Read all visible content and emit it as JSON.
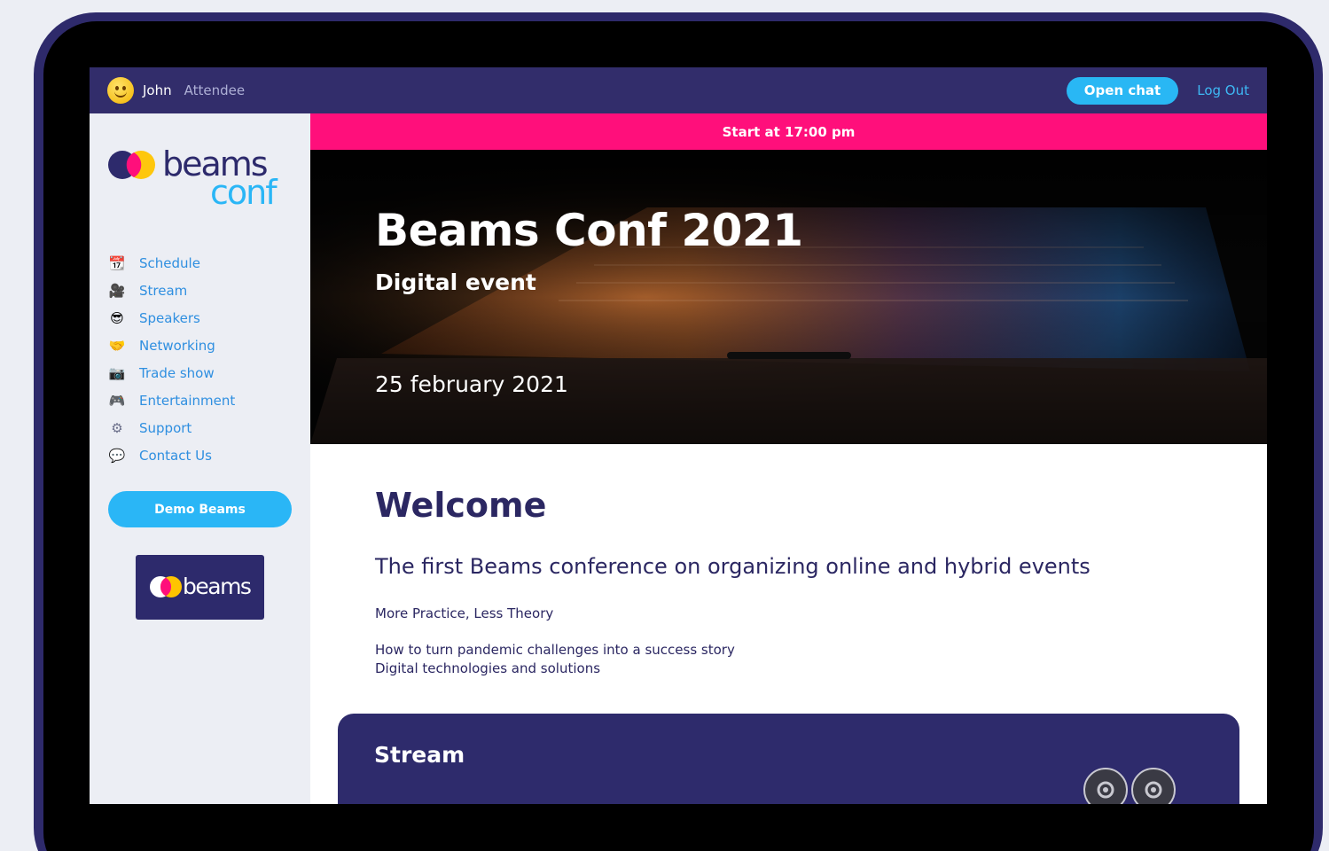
{
  "topbar": {
    "user_name": "John",
    "user_role": "Attendee",
    "open_chat": "Open chat",
    "logout": "Log Out"
  },
  "logo": {
    "line1": "beams",
    "line2": "conf"
  },
  "sidebar": {
    "items": [
      {
        "label": "Schedule",
        "icon": "calendar-icon",
        "glyph": "📆"
      },
      {
        "label": "Stream",
        "icon": "movie-camera-icon",
        "glyph": "🎥"
      },
      {
        "label": "Speakers",
        "icon": "sunglasses-face-icon",
        "glyph": "😎"
      },
      {
        "label": "Networking",
        "icon": "handshake-icon",
        "glyph": "🤝"
      },
      {
        "label": "Trade show",
        "icon": "camera-icon",
        "glyph": "📷"
      },
      {
        "label": "Entertainment",
        "icon": "gamepad-icon",
        "glyph": "🎮"
      },
      {
        "label": "Support",
        "icon": "gear-icon",
        "glyph": "⚙"
      },
      {
        "label": "Contact Us",
        "icon": "speech-bubble-icon",
        "glyph": "💬"
      }
    ],
    "demo_button": "Demo Beams",
    "badge_text": "beams"
  },
  "banner": {
    "text": "Start at 17:00 pm"
  },
  "hero": {
    "title": "Beams Conf 2021",
    "subtitle": "Digital event",
    "date": "25 february 2021"
  },
  "welcome": {
    "title": "Welcome",
    "lead": "The first Beams conference on organizing online and hybrid events",
    "p1": "More Practice, Less Theory",
    "p2": "How to turn pandemic challenges into a success story",
    "p3": "Digital technologies and solutions"
  },
  "stream_card": {
    "title": "Stream"
  },
  "colors": {
    "navy": "#322d6b",
    "accent_blue": "#29b7f4",
    "banner_pink": "#ff0f7b",
    "link_blue": "#2f8fe0"
  }
}
